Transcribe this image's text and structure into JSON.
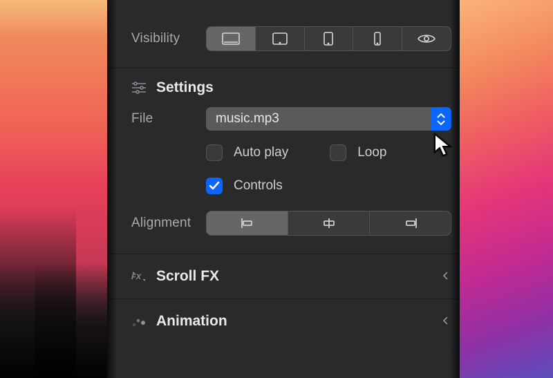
{
  "visibility": {
    "label": "Visibility",
    "options": [
      "desktop",
      "tablet-landscape",
      "tablet-portrait",
      "phone",
      "visible"
    ],
    "selected_index": 0
  },
  "settings": {
    "title": "Settings",
    "file_label": "File",
    "file_value": "music.mp3",
    "autoplay_label": "Auto play",
    "autoplay_checked": false,
    "loop_label": "Loop",
    "loop_checked": false,
    "controls_label": "Controls",
    "controls_checked": true,
    "alignment_label": "Alignment",
    "alignment_options": [
      "left",
      "center",
      "right"
    ],
    "alignment_selected": 0
  },
  "scrollfx": {
    "title": "Scroll FX"
  },
  "animation": {
    "title": "Animation"
  },
  "colors": {
    "accent": "#0a66ff",
    "panel_bg": "#2a2a2d",
    "segment_bg": "#3a3a3c",
    "segment_active": "#666669"
  }
}
